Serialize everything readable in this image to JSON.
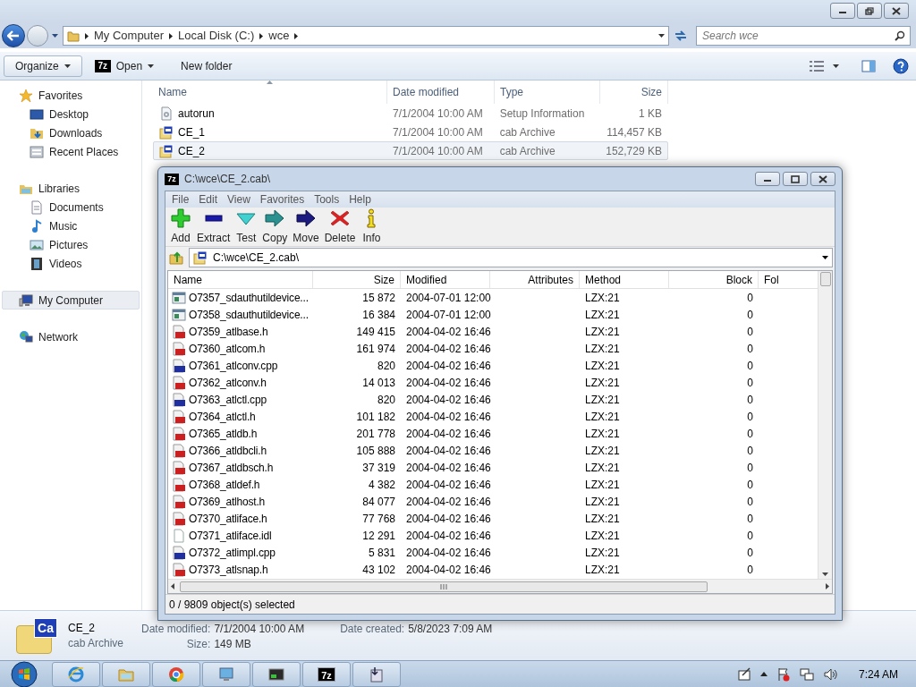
{
  "explorer": {
    "window_controls": [
      {
        "kind": "minimize"
      },
      {
        "kind": "restore"
      },
      {
        "kind": "close"
      }
    ],
    "address": [
      "My Computer",
      "Local Disk (C:)",
      "wce"
    ],
    "search": {
      "placeholder": "Search wce"
    },
    "toolbar": [
      {
        "label": "Organize",
        "kind": "menu"
      },
      {
        "label": "Open",
        "kind": "open",
        "logo_text": "7z"
      },
      {
        "label": "New folder",
        "kind": "plain"
      }
    ],
    "sidebar": [
      {
        "label": "Favorites",
        "kind": "star",
        "selected": false,
        "children": [
          {
            "label": "Desktop",
            "kind": "desktop",
            "selected": false
          },
          {
            "label": "Downloads",
            "kind": "downloads",
            "selected": false
          },
          {
            "label": "Recent Places",
            "kind": "recent",
            "selected": false
          }
        ]
      },
      {
        "label": "Libraries",
        "kind": "library",
        "selected": false,
        "children": [
          {
            "label": "Documents",
            "kind": "documents",
            "selected": false
          },
          {
            "label": "Music",
            "kind": "music",
            "selected": false
          },
          {
            "label": "Pictures",
            "kind": "pictures",
            "selected": false
          },
          {
            "label": "Videos",
            "kind": "videos",
            "selected": false
          }
        ]
      },
      {
        "label": "My Computer",
        "kind": "computer",
        "selected": true
      },
      {
        "label": "Network",
        "kind": "network",
        "selected": false
      }
    ],
    "columns": [
      "Name",
      "Date modified",
      "Type",
      "Size"
    ],
    "rows": [
      {
        "name": "autorun",
        "date": "7/1/2004 10:00 AM",
        "type": "Setup Information",
        "size": "1 KB",
        "kind": "setup",
        "selected": false
      },
      {
        "name": "CE_1",
        "date": "7/1/2004 10:00 AM",
        "type": "cab Archive",
        "size": "114,457 KB",
        "kind": "cab",
        "selected": false
      },
      {
        "name": "CE_2",
        "date": "7/1/2004 10:00 AM",
        "type": "cab Archive",
        "size": "152,729 KB",
        "kind": "cab",
        "selected": true
      }
    ],
    "details": {
      "icon_label": "Ca",
      "name": "CE_2",
      "type": "cab Archive",
      "fields": [
        {
          "label": "Date modified:",
          "value": "7/1/2004 10:00 AM"
        },
        {
          "label": "Date created:",
          "value": "5/8/2023 7:09 AM"
        },
        {
          "label": "Size:",
          "value": "149 MB"
        }
      ]
    }
  },
  "archive_window": {
    "logo_text": "7z",
    "title": "C:\\wce\\CE_2.cab\\",
    "menu": [
      "File",
      "Edit",
      "View",
      "Favorites",
      "Tools",
      "Help"
    ],
    "tools": [
      {
        "label": "Add",
        "kind": "add"
      },
      {
        "label": "Extract",
        "kind": "extract"
      },
      {
        "label": "Test",
        "kind": "test"
      },
      {
        "label": "Copy",
        "kind": "copy"
      },
      {
        "label": "Move",
        "kind": "move"
      },
      {
        "label": "Delete",
        "kind": "delete"
      },
      {
        "label": "Info",
        "kind": "info"
      }
    ],
    "path": "C:\\wce\\CE_2.cab\\",
    "columns": [
      "Name",
      "Size",
      "Modified",
      "Attributes",
      "Method",
      "Block",
      "Fol"
    ],
    "rows": [
      {
        "name": "O7357_sdauthutildevice...",
        "size": "15 872",
        "modified": "2004-07-01 12:00",
        "method": "LZX:21",
        "block": "0",
        "kind": "exe"
      },
      {
        "name": "O7358_sdauthutildevice...",
        "size": "16 384",
        "modified": "2004-07-01 12:00",
        "method": "LZX:21",
        "block": "0",
        "kind": "exe"
      },
      {
        "name": "O7359_atlbase.h",
        "size": "149 415",
        "modified": "2004-04-02 16:46",
        "method": "LZX:21",
        "block": "0",
        "kind": "h"
      },
      {
        "name": "O7360_atlcom.h",
        "size": "161 974",
        "modified": "2004-04-02 16:46",
        "method": "LZX:21",
        "block": "0",
        "kind": "h"
      },
      {
        "name": "O7361_atlconv.cpp",
        "size": "820",
        "modified": "2004-04-02 16:46",
        "method": "LZX:21",
        "block": "0",
        "kind": "cpp"
      },
      {
        "name": "O7362_atlconv.h",
        "size": "14 013",
        "modified": "2004-04-02 16:46",
        "method": "LZX:21",
        "block": "0",
        "kind": "h"
      },
      {
        "name": "O7363_atlctl.cpp",
        "size": "820",
        "modified": "2004-04-02 16:46",
        "method": "LZX:21",
        "block": "0",
        "kind": "cpp"
      },
      {
        "name": "O7364_atlctl.h",
        "size": "101 182",
        "modified": "2004-04-02 16:46",
        "method": "LZX:21",
        "block": "0",
        "kind": "h"
      },
      {
        "name": "O7365_atldb.h",
        "size": "201 778",
        "modified": "2004-04-02 16:46",
        "method": "LZX:21",
        "block": "0",
        "kind": "h"
      },
      {
        "name": "O7366_atldbcli.h",
        "size": "105 888",
        "modified": "2004-04-02 16:46",
        "method": "LZX:21",
        "block": "0",
        "kind": "h"
      },
      {
        "name": "O7367_atldbsch.h",
        "size": "37 319",
        "modified": "2004-04-02 16:46",
        "method": "LZX:21",
        "block": "0",
        "kind": "h"
      },
      {
        "name": "O7368_atldef.h",
        "size": "4 382",
        "modified": "2004-04-02 16:46",
        "method": "LZX:21",
        "block": "0",
        "kind": "h"
      },
      {
        "name": "O7369_atlhost.h",
        "size": "84 077",
        "modified": "2004-04-02 16:46",
        "method": "LZX:21",
        "block": "0",
        "kind": "h"
      },
      {
        "name": "O7370_atliface.h",
        "size": "77 768",
        "modified": "2004-04-02 16:46",
        "method": "LZX:21",
        "block": "0",
        "kind": "h"
      },
      {
        "name": "O7371_atliface.idl",
        "size": "12 291",
        "modified": "2004-04-02 16:46",
        "method": "LZX:21",
        "block": "0",
        "kind": "idl"
      },
      {
        "name": "O7372_atlimpl.cpp",
        "size": "5 831",
        "modified": "2004-04-02 16:46",
        "method": "LZX:21",
        "block": "0",
        "kind": "cpp"
      },
      {
        "name": "O7373_atlsnap.h",
        "size": "43 102",
        "modified": "2004-04-02 16:46",
        "method": "LZX:21",
        "block": "0",
        "kind": "h"
      }
    ],
    "status": "0 / 9809 object(s) selected"
  },
  "taskbar": {
    "apps": [
      {
        "kind": "browser-e"
      },
      {
        "kind": "folder"
      },
      {
        "kind": "chrome"
      },
      {
        "kind": "monitor"
      },
      {
        "kind": "terminal"
      },
      {
        "kind": "archiver",
        "logo_text": "7z"
      },
      {
        "kind": "installer"
      }
    ],
    "time": "7:24 AM"
  }
}
